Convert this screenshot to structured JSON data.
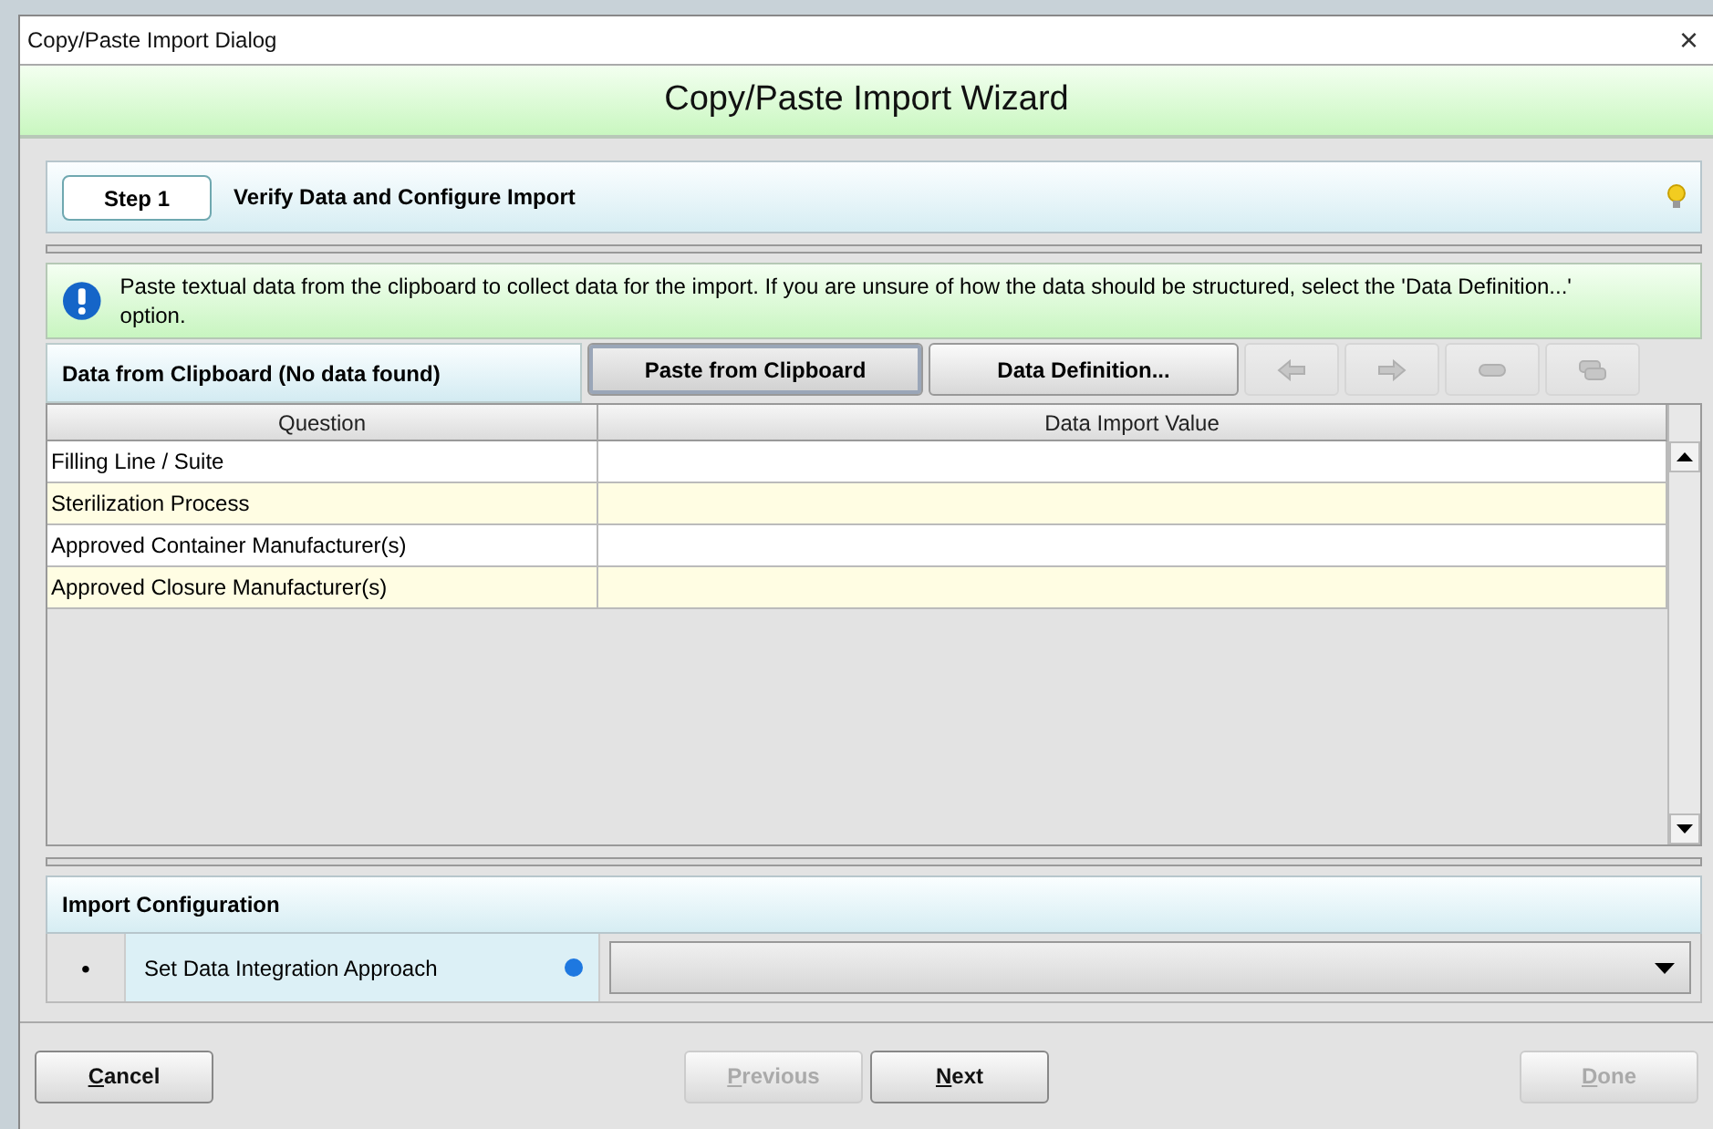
{
  "window": {
    "title": "Copy/Paste Import Dialog",
    "close": "×"
  },
  "header": {
    "title": "Copy/Paste Import Wizard"
  },
  "step": {
    "badge": "Step 1",
    "title": "Verify Data and Configure Import"
  },
  "info": {
    "text": "Paste textual data from the clipboard to collect data for the import. If you are unsure of how the data should be structured, select the 'Data Definition...' option."
  },
  "toolbar": {
    "label": "Data from Clipboard (No data found)",
    "buttons": [
      {
        "label": "Paste from Clipboard",
        "selected": true
      },
      {
        "label": "Data Definition...",
        "selected": false
      }
    ],
    "icon_buttons": [
      {
        "kind": "left",
        "disabled": true
      },
      {
        "kind": "right",
        "disabled": true
      },
      {
        "kind": "remove",
        "disabled": true
      },
      {
        "kind": "copy",
        "disabled": true
      }
    ]
  },
  "table": {
    "columns": [
      "Question",
      "Data Import Value"
    ],
    "rows": [
      {
        "question": "Filling Line / Suite"
      },
      {
        "question": "Sterilization Process"
      },
      {
        "question": "Approved Container Manufacturer(s)"
      },
      {
        "question": "Approved Closure Manufacturer(s)"
      }
    ]
  },
  "config": {
    "title": "Import Configuration",
    "rows": [
      {
        "bullet": "•",
        "label": "Set Data Integration Approach",
        "required": true
      }
    ]
  },
  "footer": {
    "cancel": {
      "label": "Cancel",
      "disabled": false
    },
    "navigation": [
      {
        "label": "Previous",
        "disabled": true
      },
      {
        "label": "Next",
        "disabled": false
      }
    ],
    "done": {
      "label": "Done",
      "disabled": true
    }
  }
}
